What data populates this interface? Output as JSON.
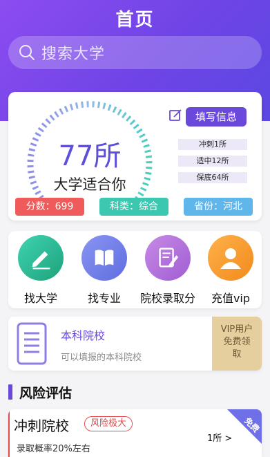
{
  "header": {
    "title": "首页"
  },
  "search": {
    "placeholder": "搜索大学"
  },
  "summary": {
    "count": "77所",
    "subtitle": "大学适合你",
    "fill_button": "填写信息",
    "tiers": [
      "冲刺1所",
      "适中12所",
      "保底64所"
    ],
    "score_tag": "分数：699",
    "subject_tag": "科类：综合",
    "province_tag": "省份：河北",
    "colors": {
      "score": "#ef5a5a",
      "subject": "#3cc7b0",
      "province": "#5fb6ea"
    }
  },
  "nav": [
    {
      "label": "找大学",
      "icon": "pen-icon"
    },
    {
      "label": "找专业",
      "icon": "book-icon"
    },
    {
      "label": "院校录取分",
      "icon": "document-edit-icon"
    },
    {
      "label": "充值vip",
      "icon": "user-icon"
    }
  ],
  "vip_card": {
    "title": "本科院校",
    "description": "可以填报的本科院校",
    "side_text_1": "VIP用户",
    "side_text_2": "免费领",
    "side_text_3": "取"
  },
  "risk_section": {
    "title": "风险评估"
  },
  "risk_card": {
    "title": "冲刺院校",
    "badge": "风险极大",
    "probability": "录取概率20%左右",
    "count": "1所 >",
    "corner_label": "免费"
  }
}
